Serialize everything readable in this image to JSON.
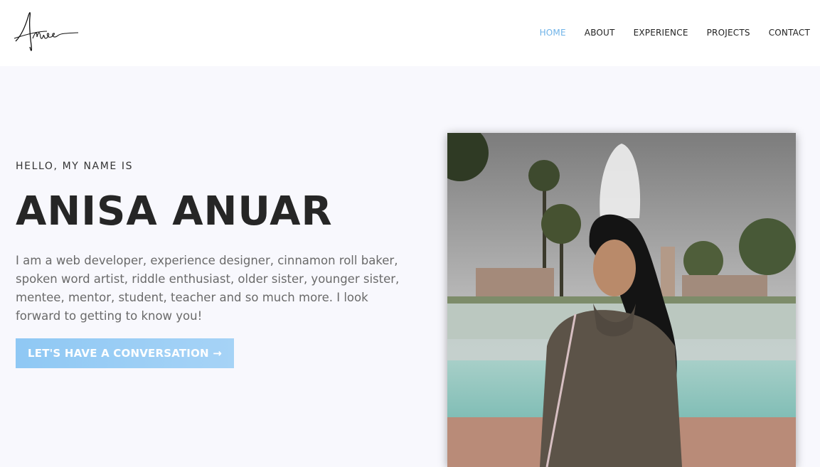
{
  "header": {
    "logo_text": "Anisa",
    "nav": [
      {
        "label": "HOME",
        "active": true
      },
      {
        "label": "ABOUT",
        "active": false
      },
      {
        "label": "EXPERIENCE",
        "active": false
      },
      {
        "label": "PROJECTS",
        "active": false
      },
      {
        "label": "CONTACT",
        "active": false
      }
    ]
  },
  "hero": {
    "greeting": "HELLO, MY NAME IS",
    "name": "ANISA ANUAR",
    "bio": "I am a web developer, experience designer, cinnamon roll baker, spoken word artist, riddle enthusiast, older sister, younger sister, mentee, mentor, student, teacher and so much more. I look forward to getting to know you!",
    "cta_label": "LET'S HAVE A CONVERSATION →"
  },
  "colors": {
    "accent": "#6fb3e8",
    "button": "#94cbf5",
    "background": "#f8f8fd"
  }
}
